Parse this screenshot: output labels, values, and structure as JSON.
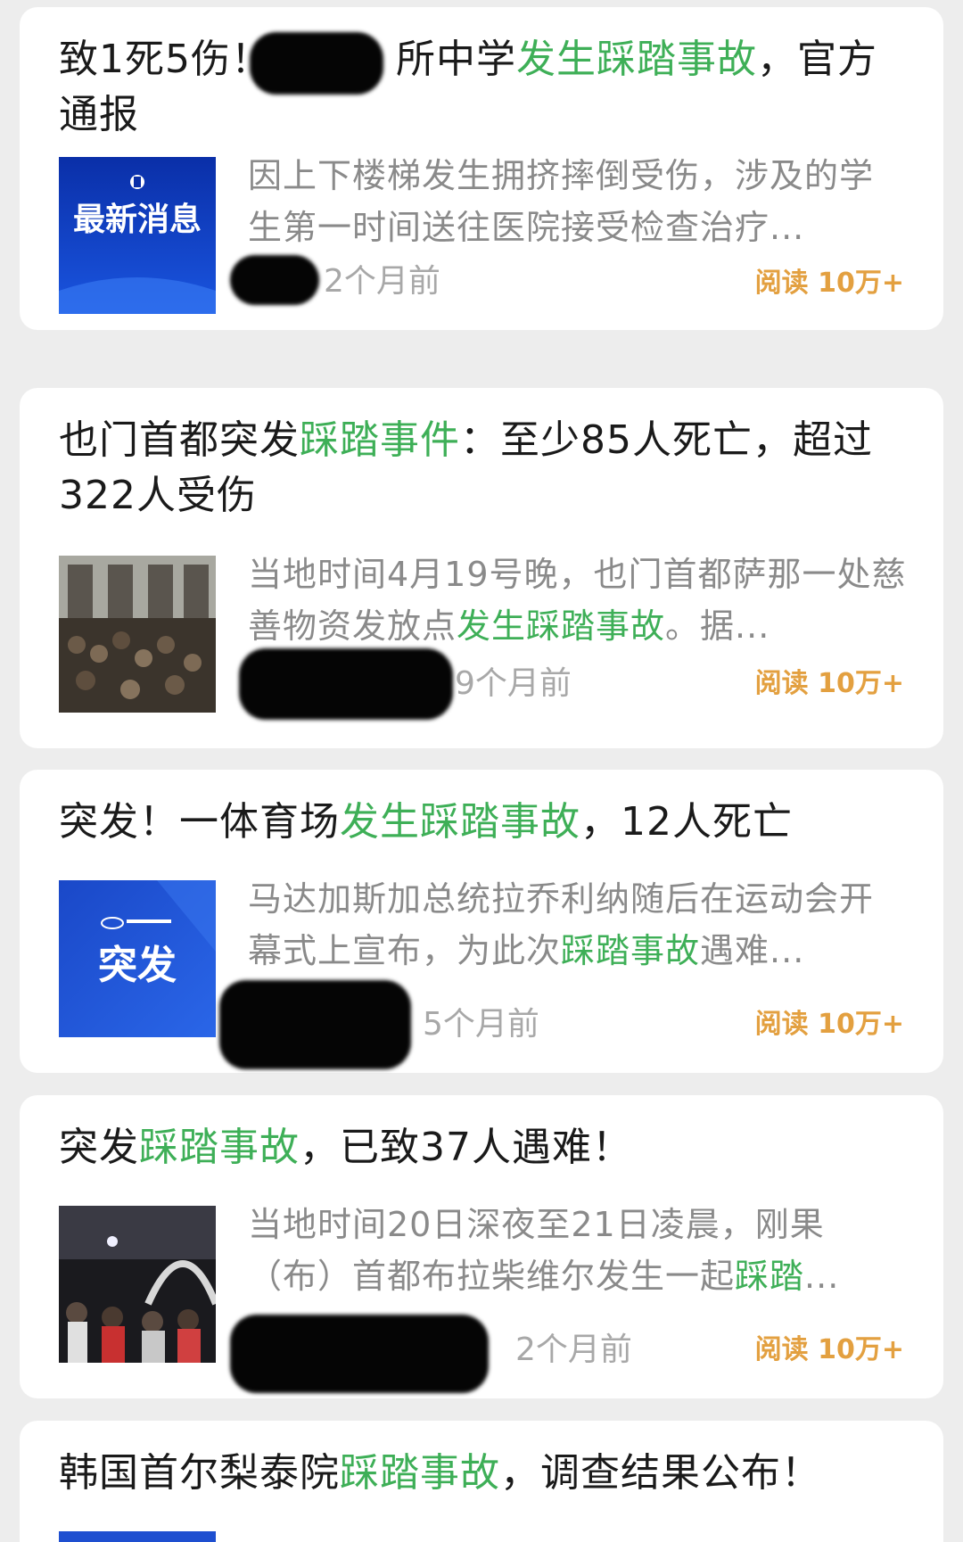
{
  "articles": [
    {
      "title_parts": [
        {
          "text": "致1死5伤！",
          "hl": false
        },
        {
          "text": "所中学",
          "hl": false
        },
        {
          "text": "发生踩踏事故",
          "hl": true
        },
        {
          "text": "，官方通报",
          "hl": false
        }
      ],
      "snippet_parts": [
        {
          "text": "因上下楼梯发生拥挤摔倒受伤，涉及的学生第一时间送往医院接受检查治疗...",
          "hl": false
        }
      ],
      "thumbnail": {
        "kind": "logo-banner",
        "text": "最新消息",
        "icon": "government-emblem-icon",
        "color": "#1a3fbf"
      },
      "time": "2个月前",
      "reads": "阅读 10万+"
    },
    {
      "title_parts": [
        {
          "text": "也门首都突发",
          "hl": false
        },
        {
          "text": "踩踏事件",
          "hl": true
        },
        {
          "text": "：至少85人死亡，超过322人受伤",
          "hl": false
        }
      ],
      "snippet_parts": [
        {
          "text": "当地时间4月19号晚，也门首都萨那一处慈善物资发放点",
          "hl": false
        },
        {
          "text": "发生踩踏事故",
          "hl": true
        },
        {
          "text": "。据...",
          "hl": false
        }
      ],
      "thumbnail": {
        "kind": "photo-crowd-gate",
        "icon": "crowd-photo"
      },
      "time": "9个月前",
      "reads": "阅读 10万+"
    },
    {
      "title_parts": [
        {
          "text": "突发！一体育场",
          "hl": false
        },
        {
          "text": "发生踩踏事故",
          "hl": true
        },
        {
          "text": "，12人死亡",
          "hl": false
        }
      ],
      "snippet_parts": [
        {
          "text": "马达加斯加总统拉乔利纳随后在运动会开幕式上宣布，为此次",
          "hl": false
        },
        {
          "text": "踩踏事故",
          "hl": true
        },
        {
          "text": "遇难...",
          "hl": false
        }
      ],
      "thumbnail": {
        "kind": "logo-banner",
        "text": "突发",
        "icon": "news-agency-logo",
        "color": "#1e4fd0"
      },
      "time": "5个月前",
      "reads": "阅读 10万+"
    },
    {
      "title_parts": [
        {
          "text": "突发",
          "hl": false
        },
        {
          "text": "踩踏事故",
          "hl": true
        },
        {
          "text": "，已致37人遇难！",
          "hl": false
        }
      ],
      "snippet_parts": [
        {
          "text": "当地时间20日深夜至21日凌晨，刚果（布）首都布拉柴维尔发生一起",
          "hl": false
        },
        {
          "text": "踩踏",
          "hl": true
        },
        {
          "text": "...",
          "hl": false
        }
      ],
      "thumbnail": {
        "kind": "photo-night-crowd",
        "icon": "crowd-photo"
      },
      "time": "2个月前",
      "reads": "阅读 10万+"
    },
    {
      "title_parts": [
        {
          "text": "韩国首尔梨泰院",
          "hl": false
        },
        {
          "text": "踩踏事故",
          "hl": true
        },
        {
          "text": "，调查结果公布！",
          "hl": false
        }
      ],
      "snippet_parts": [],
      "thumbnail": {
        "kind": "logo-banner",
        "text": "",
        "icon": "news-logo",
        "color": "#1e4fd0"
      },
      "time": "",
      "reads": ""
    }
  ],
  "colors": {
    "highlight": "#3eaf57",
    "title": "#1a1a1a",
    "snippet": "#8a8a8a",
    "reads": "#e3a040",
    "time": "#a8a8a8",
    "background": "#ededed"
  }
}
